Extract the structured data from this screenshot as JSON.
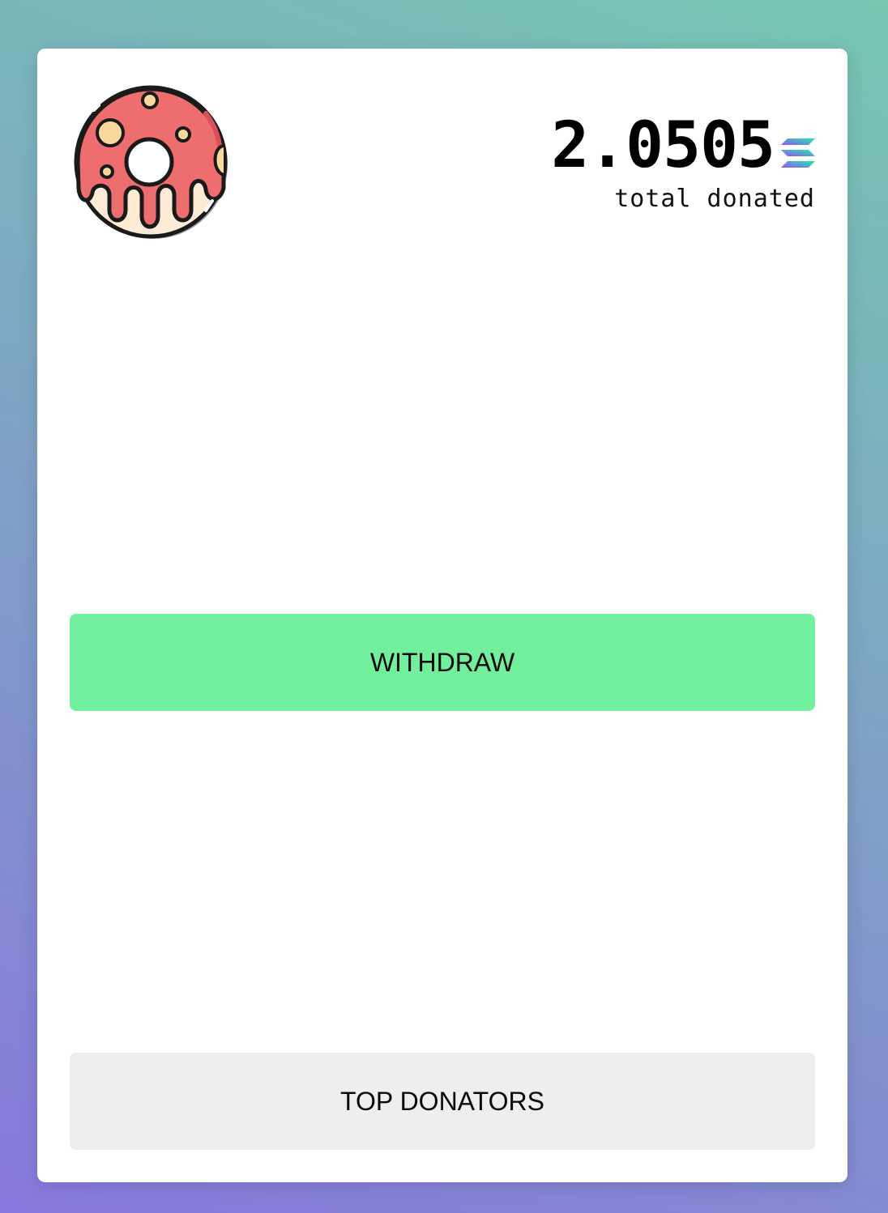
{
  "stats": {
    "total_amount": "2.0505",
    "caption": "total donated",
    "currency_icon": "solana-icon"
  },
  "logo": {
    "icon": "donut-icon",
    "colors": {
      "frosting": "#ee6d6e",
      "dough": "#fdebd6",
      "sprinkles": "#f9d89d",
      "outline": "#1a1a1a"
    }
  },
  "actions": {
    "withdraw_label": "WITHDRAW",
    "top_donators_label": "TOP DONATORS"
  },
  "colors": {
    "withdraw_button": "#71ef9c",
    "secondary_button": "#eeeeee",
    "card": "#ffffff"
  }
}
